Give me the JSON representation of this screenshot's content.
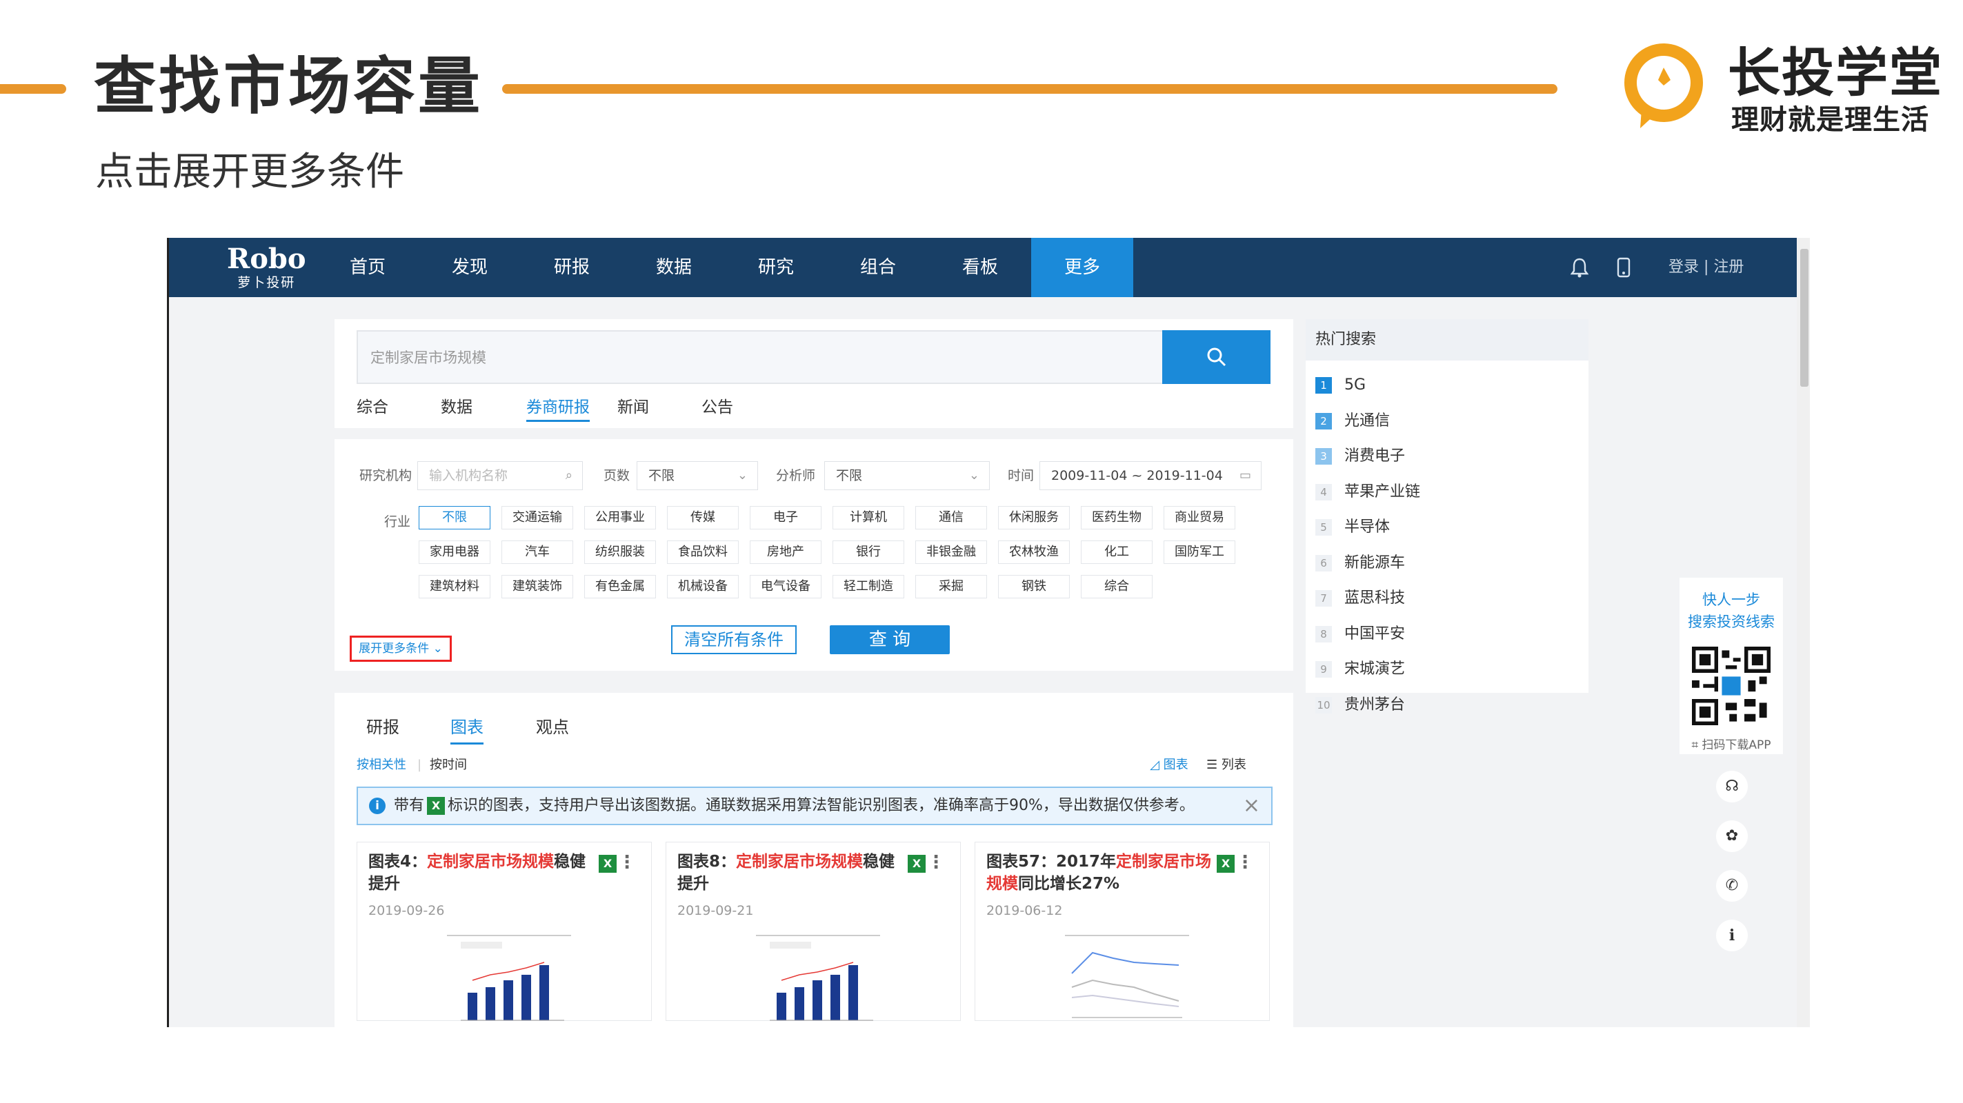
{
  "slide": {
    "title": "查找市场容量",
    "subtitle": "点击展开更多条件",
    "brand_name": "长投学堂",
    "brand_slogan": "理财就是理生活"
  },
  "nav": {
    "logo_main": "Robo",
    "logo_sub": "萝卜投研",
    "items": [
      "首页",
      "发现",
      "研报",
      "数据",
      "研究",
      "组合",
      "看板",
      "更多"
    ],
    "active_item": "更多",
    "login": "登录 | 注册"
  },
  "search": {
    "query": "定制家居市场规模",
    "tabs": [
      "综合",
      "数据",
      "券商研报",
      "新闻",
      "公告"
    ],
    "active_tab": "券商研报"
  },
  "filters": {
    "org_label": "研究机构",
    "org_placeholder": "输入机构名称",
    "pages_label": "页数",
    "pages_value": "不限",
    "analyst_label": "分析师",
    "analyst_value": "不限",
    "time_label": "时间",
    "time_value": "2009-11-04 ~ 2019-11-04",
    "industry_label": "行业",
    "industries": [
      "不限",
      "交通运输",
      "公用事业",
      "传媒",
      "电子",
      "计算机",
      "通信",
      "休闲服务",
      "医药生物",
      "商业贸易",
      "家用电器",
      "汽车",
      "纺织服装",
      "食品饮料",
      "房地产",
      "银行",
      "非银金融",
      "农林牧渔",
      "化工",
      "国防军工",
      "建筑材料",
      "建筑装饰",
      "有色金属",
      "机械设备",
      "电气设备",
      "轻工制造",
      "采掘",
      "钢铁",
      "综合"
    ],
    "expand_more": "展开更多条件",
    "clear_button": "清空所有条件",
    "query_button": "查 询"
  },
  "results": {
    "tabs": [
      "研报",
      "图表",
      "观点"
    ],
    "active_tab": "图表",
    "sort_relevance": "按相关性",
    "sort_time": "按时间",
    "view_chart": "图表",
    "view_list": "列表",
    "notice_prefix": "带有",
    "notice_suffix": "标识的图表，支持用户导出该图数据。通联数据采用算法智能识别图表，准确率高于90%，导出数据仅供参考。",
    "cards": [
      {
        "title_prefix": "图表4：",
        "title_highlight": "定制家居市场规模",
        "title_suffix": "稳健提升",
        "date": "2019-09-26"
      },
      {
        "title_prefix": "图表8：",
        "title_highlight": "定制家居市场规模",
        "title_suffix": "稳健提升",
        "date": "2019-09-21"
      },
      {
        "title_prefix": "图表57：2017年",
        "title_highlight": "定制家居市场规模",
        "title_suffix": "同比增长27%",
        "date": "2019-06-12"
      }
    ]
  },
  "hot_search": {
    "title": "热门搜索",
    "items": [
      {
        "rank": "1",
        "name": "5G"
      },
      {
        "rank": "2",
        "name": "光通信"
      },
      {
        "rank": "3",
        "name": "消费电子"
      },
      {
        "rank": "4",
        "name": "苹果产业链"
      },
      {
        "rank": "5",
        "name": "半导体"
      },
      {
        "rank": "6",
        "name": "新能源车"
      },
      {
        "rank": "7",
        "name": "蓝思科技"
      },
      {
        "rank": "8",
        "name": "中国平安"
      },
      {
        "rank": "9",
        "name": "宋城演艺"
      },
      {
        "rank": "10",
        "name": "贵州茅台"
      }
    ]
  },
  "float_panel": {
    "line1": "快人一步",
    "line2": "搜索投资线索",
    "download": "扫码下载APP"
  },
  "colors": {
    "accent": "#1b8ad9",
    "nav_bg": "#183f66",
    "brand_orange": "#e8962c",
    "highlight_red": "#e53935"
  }
}
